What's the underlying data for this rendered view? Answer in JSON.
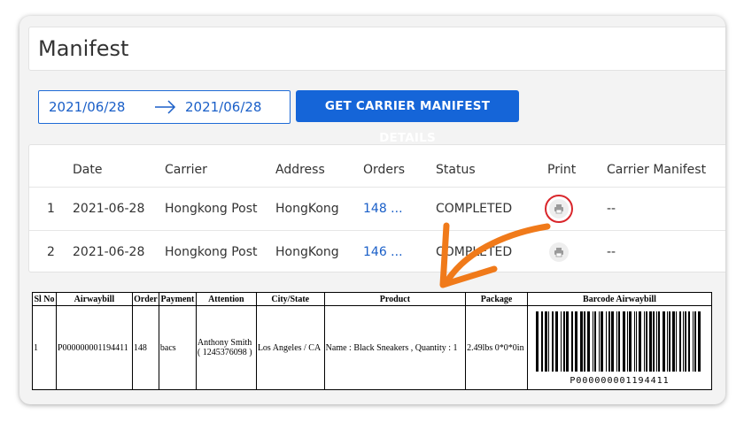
{
  "page": {
    "title": "Manifest"
  },
  "filter": {
    "from_date": "2021/06/28",
    "to_date": "2021/06/28",
    "button_label": "GET CARRIER MANIFEST DETAILS"
  },
  "table": {
    "columns": [
      "Date",
      "Carrier",
      "Address",
      "Orders",
      "Status",
      "Print",
      "Carrier Manifest"
    ],
    "rows": [
      {
        "index": "1",
        "date": "2021-06-28",
        "carrier": "Hongkong Post",
        "address": "HongKong",
        "orders": "148 ...",
        "status": "COMPLETED",
        "carrier_manifest": "--"
      },
      {
        "index": "2",
        "date": "2021-06-28",
        "carrier": "Hongkong Post",
        "address": "HongKong",
        "orders": "146 ...",
        "status": "COMPLETED",
        "carrier_manifest": "--"
      }
    ]
  },
  "manifest_doc": {
    "headers": [
      "Sl No",
      "Airwaybill",
      "Order",
      "Payment",
      "Attention",
      "City/State",
      "Product",
      "Package",
      "Barcode Airwaybill"
    ],
    "row": {
      "sl_no": "1",
      "airwaybill": "P000000001194411",
      "order": "148",
      "payment": "bacs",
      "attention_name": "Anthony Smith",
      "attention_phone": "( 1245376098 )",
      "city_state": "Los Angeles / CA",
      "product": "Name : Black Sneakers , Quantity : 1",
      "package": "2.49lbs 0*0*0in",
      "barcode_text": "P000000001194411"
    }
  },
  "colors": {
    "accent": "#1565d8",
    "link": "#1a5fc8",
    "highlight_ring": "#d9262b",
    "annotation_arrow": "#f07a1a"
  },
  "icons": {
    "print": "printer-icon",
    "range_arrow": "arrow-right-icon"
  }
}
